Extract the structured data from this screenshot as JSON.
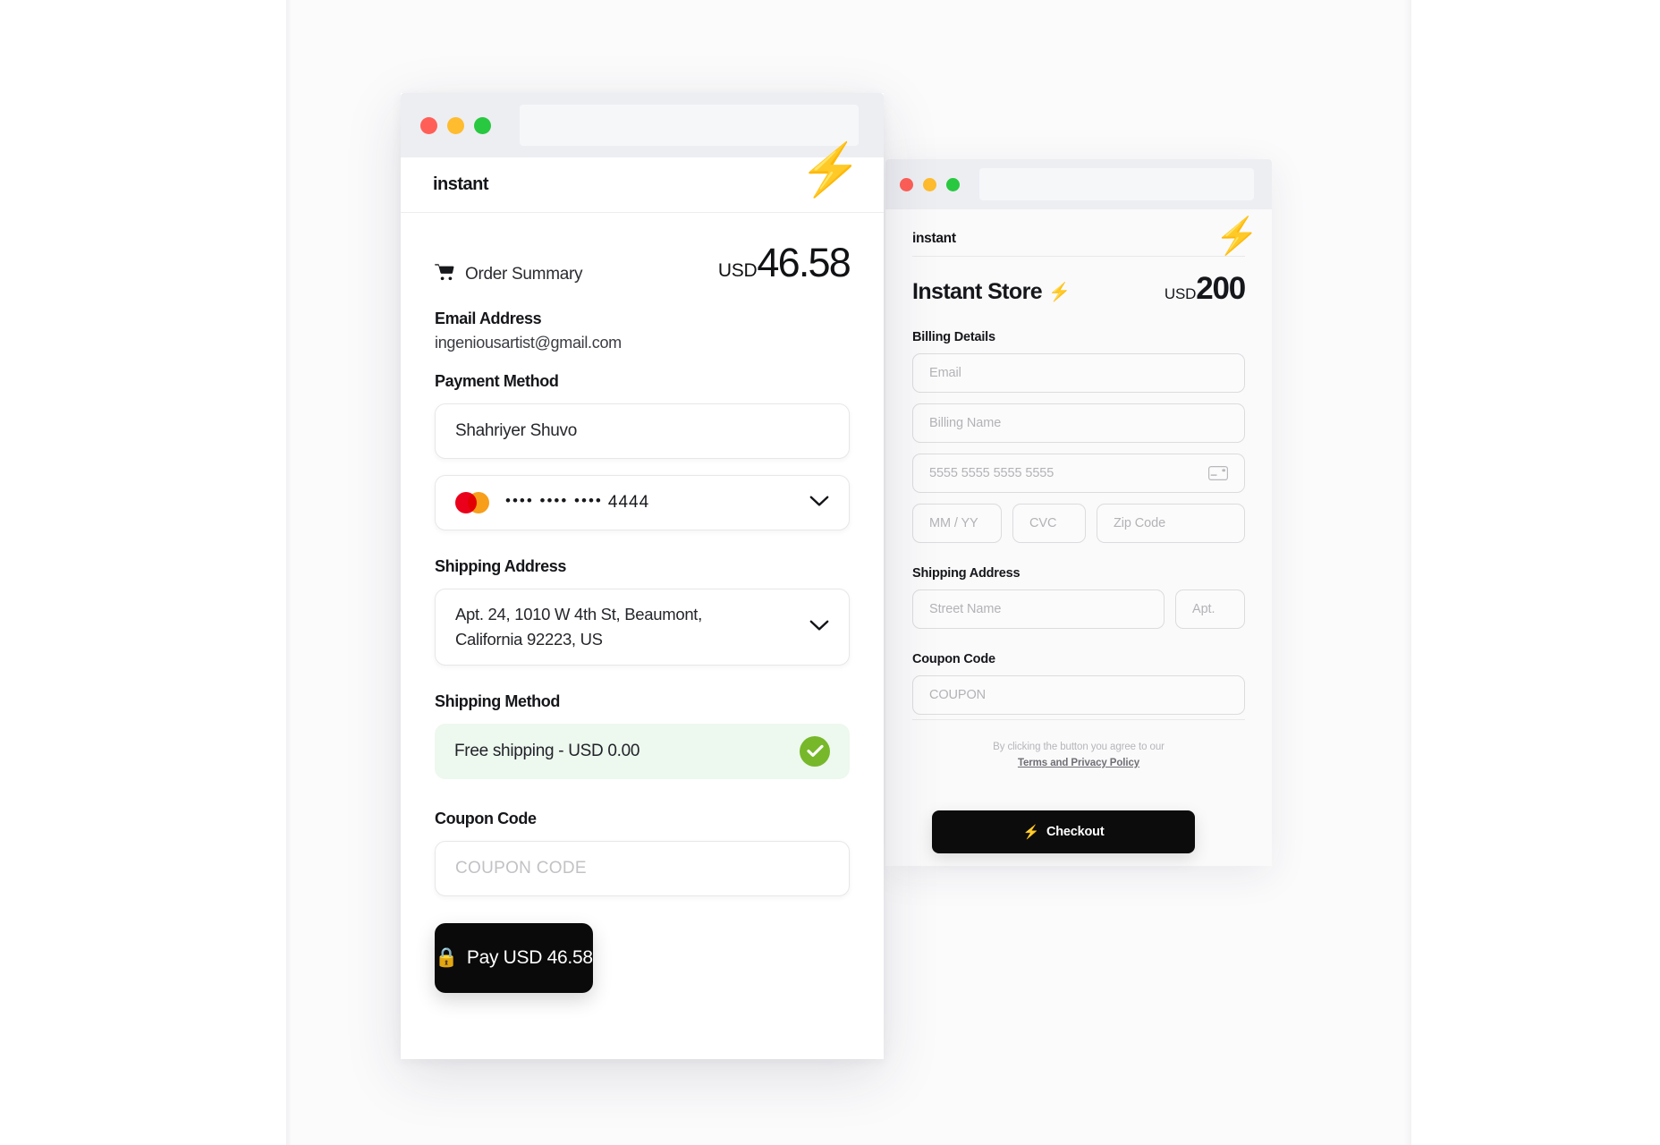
{
  "left_window": {
    "titlebar": {
      "url_value": ""
    },
    "brand": "instant",
    "bolt_icon": "⚡",
    "order_summary_label": "Order Summary",
    "cart_icon": "cart-icon",
    "total": {
      "currency": "USD",
      "amount": "46.58"
    },
    "email_section": {
      "label": "Email Address",
      "value": "ingeniousartist@gmail.com"
    },
    "payment_section": {
      "label": "Payment Method",
      "cardholder_name": "Shahriyer Shuvo",
      "card_brand": "mastercard",
      "card_mask": "•••• •••• ••••",
      "card_last4": "4444"
    },
    "shipping_address_section": {
      "label": "Shipping Address",
      "line1": "Apt. 24, 1010 W 4th St, Beaumont,",
      "line2": "California 92223, US"
    },
    "shipping_method_section": {
      "label": "Shipping Method",
      "option": "Free shipping - USD 0.00",
      "selected": true
    },
    "coupon_section": {
      "label": "Coupon Code",
      "placeholder": "COUPON CODE",
      "value": ""
    },
    "pay_button": {
      "lock_icon": "🔒",
      "label": "Pay USD 46.58"
    }
  },
  "right_window": {
    "titlebar": {
      "url_value": ""
    },
    "brand": "instant",
    "bolt_icon": "⚡",
    "store_title": "Instant Store",
    "store_title_bolt": "⚡",
    "total": {
      "currency": "USD",
      "amount": "200"
    },
    "billing_section": {
      "label": "Billing Details",
      "email_placeholder": "Email",
      "billing_name_placeholder": "Billing Name",
      "card_number_placeholder": "5555  5555  5555  5555",
      "card_icon": "credit-card-icon",
      "expiry_placeholder": "MM / YY",
      "cvc_placeholder": "CVC",
      "zip_placeholder": "Zip Code"
    },
    "shipping_section": {
      "label": "Shipping Address",
      "street_placeholder": "Street Name",
      "apt_placeholder": "Apt."
    },
    "coupon_section": {
      "label": "Coupon Code",
      "placeholder": "COUPON"
    },
    "terms": {
      "text": "By clicking the button you agree to our",
      "link": "Terms and Privacy Policy"
    },
    "checkout_button": {
      "bolt_icon": "⚡",
      "label": "Checkout"
    }
  },
  "colors": {
    "accent_bolt": "#FFD21E",
    "success_green": "#76B82A",
    "success_bg": "#EDF8EE",
    "button_black": "#0A0A0A",
    "mastercard_red": "#EB001B",
    "mastercard_orange": "#F79E1B",
    "dot_red": "#FF5F57",
    "dot_yellow": "#FEBC2E",
    "dot_green": "#28C840"
  }
}
